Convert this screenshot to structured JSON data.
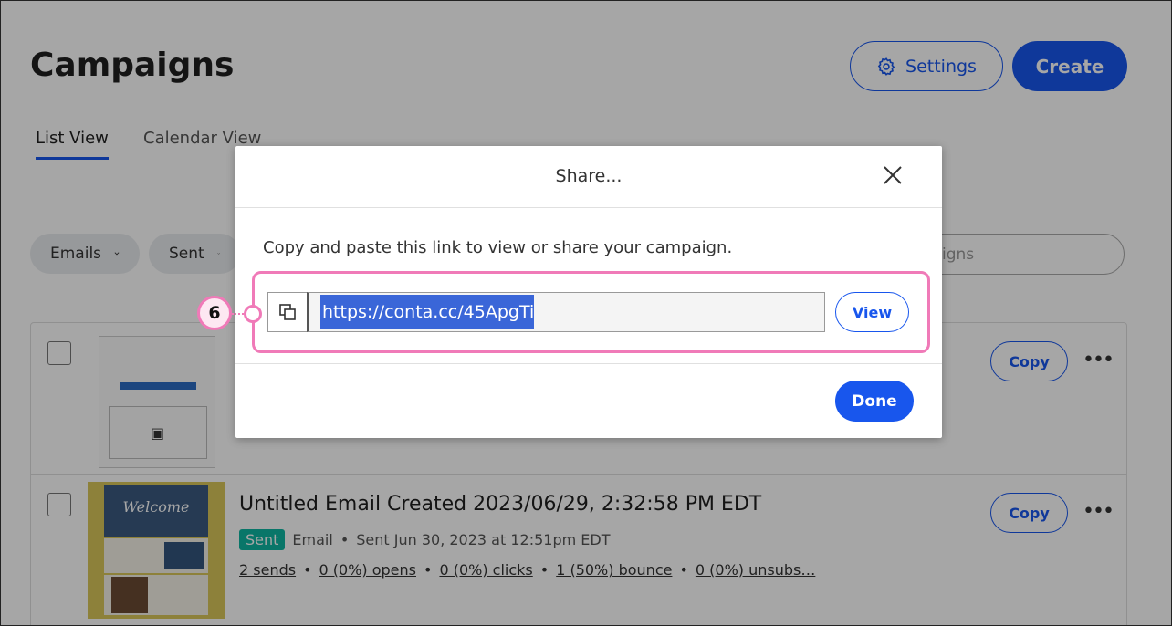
{
  "page": {
    "title": "Campaigns",
    "settings_label": "Settings",
    "create_label": "Create",
    "tabs": [
      {
        "label": "List View"
      },
      {
        "label": "Calendar View"
      }
    ],
    "filters": [
      {
        "label": "Emails"
      },
      {
        "label": "Sent"
      }
    ],
    "search_placeholder_visible": "igns"
  },
  "campaigns": [
    {
      "title": "",
      "copy_label": "Copy",
      "more_label": "•••"
    },
    {
      "title": "Untitled Email Created 2023/06/29, 2:32:58 PM EDT",
      "badge": "Sent",
      "type": "Email",
      "sent_text": "Sent Jun 30, 2023 at 12:51pm EDT",
      "stats": [
        "2 sends",
        "0 (0%) opens",
        "0 (0%) clicks",
        "1 (50%) bounce",
        "0 (0%) unsubs…"
      ],
      "thumb_text": "Welcome",
      "copy_label": "Copy",
      "more_label": "•••"
    }
  ],
  "modal": {
    "title": "Share...",
    "description": "Copy and paste this link to view or share your campaign.",
    "url": "https://conta.cc/45ApgTi",
    "view_label": "View",
    "done_label": "Done"
  },
  "callout": {
    "number": "6"
  },
  "colors": {
    "primary": "#1856ed",
    "highlight": "#f07ab8",
    "sent_badge": "#0fb5a2",
    "selection": "#3a66d8"
  }
}
